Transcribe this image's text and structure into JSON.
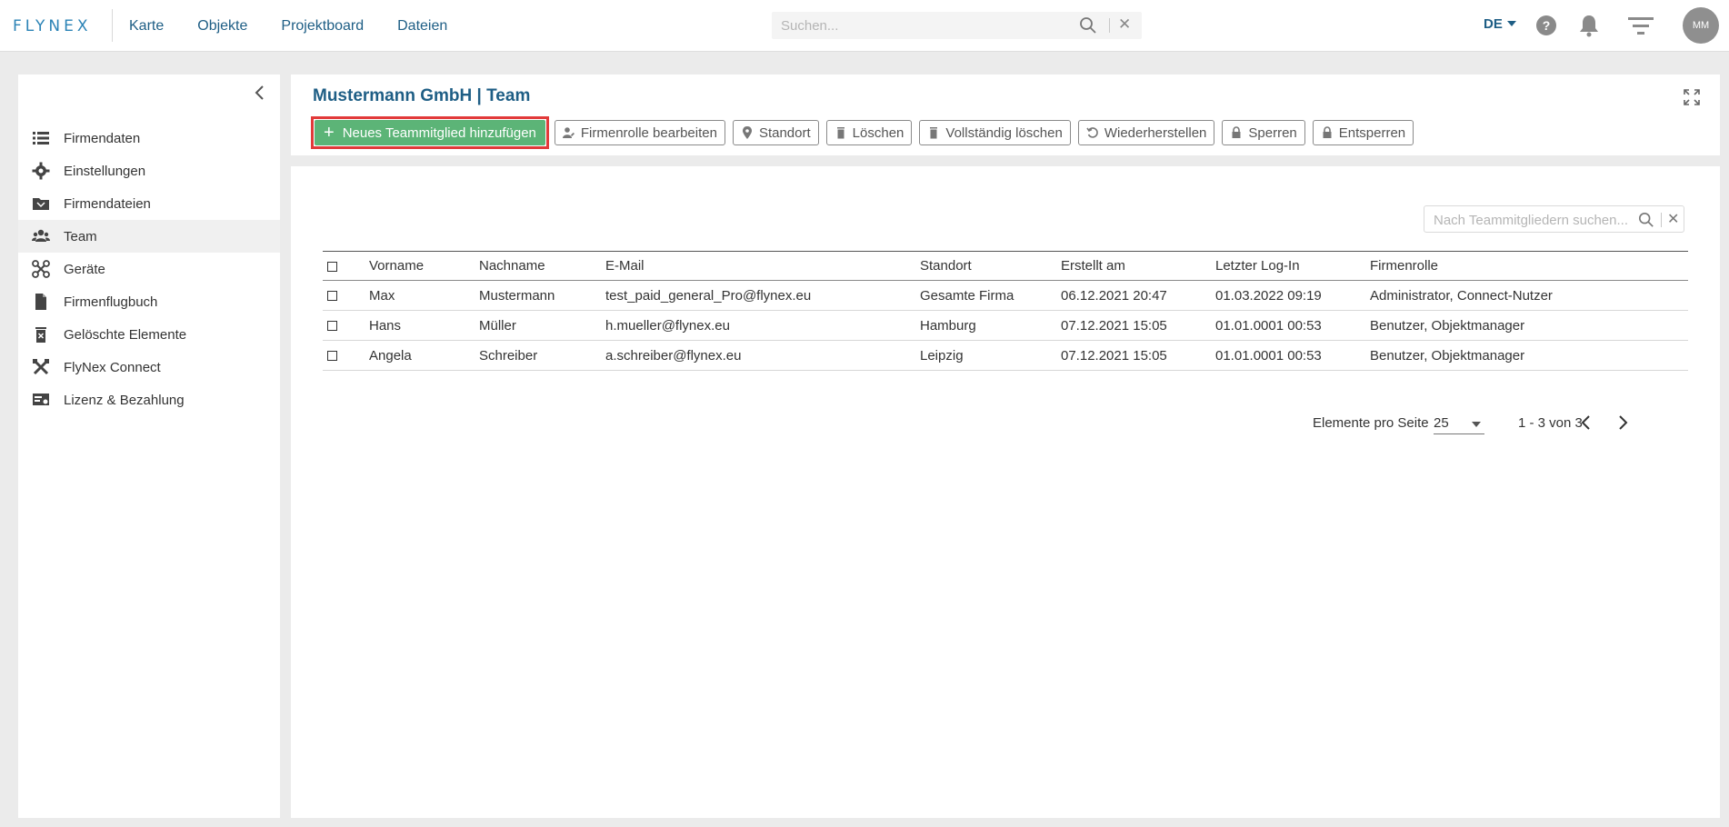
{
  "topbar": {
    "logo": "FLYNEX",
    "nav": [
      "Karte",
      "Objekte",
      "Projektboard",
      "Dateien"
    ],
    "search_placeholder": "Suchen...",
    "clear": "✕",
    "language": "DE",
    "help": "?",
    "avatar": "MM"
  },
  "sidebar": {
    "items": [
      {
        "label": "Firmendaten",
        "icon": "list-icon"
      },
      {
        "label": "Einstellungen",
        "icon": "gear-icon"
      },
      {
        "label": "Firmendateien",
        "icon": "folder-icon"
      },
      {
        "label": "Team",
        "icon": "team-icon"
      },
      {
        "label": "Geräte",
        "icon": "drone-icon"
      },
      {
        "label": "Firmenflugbuch",
        "icon": "file-icon"
      },
      {
        "label": "Gelöschte Elemente",
        "icon": "trash-icon"
      },
      {
        "label": "FlyNex Connect",
        "icon": "tools-icon"
      },
      {
        "label": "Lizenz & Bezahlung",
        "icon": "license-icon"
      }
    ],
    "active": "Team"
  },
  "header": {
    "title": "Mustermann GmbH | Team",
    "primary_button": "Neues Teammitglied hinzufügen",
    "buttons": [
      "Firmenrolle bearbeiten",
      "Standort",
      "Löschen",
      "Vollständig löschen",
      "Wiederherstellen",
      "Sperren",
      "Entsperren"
    ]
  },
  "table": {
    "search_placeholder": "Nach Teammitgliedern suchen...",
    "clear": "✕",
    "columns": [
      "Vorname",
      "Nachname",
      "E-Mail",
      "Standort",
      "Erstellt am",
      "Letzter Log-In",
      "Firmenrolle"
    ],
    "rows": [
      [
        "Max",
        "Mustermann",
        "test_paid_general_Pro@flynex.eu",
        "Gesamte Firma",
        "06.12.2021 20:47",
        "01.03.2022 09:19",
        "Administrator, Connect-Nutzer"
      ],
      [
        "Hans",
        "Müller",
        "h.mueller@flynex.eu",
        "Hamburg",
        "07.12.2021 15:05",
        "01.01.0001 00:53",
        "Benutzer, Objektmanager"
      ],
      [
        "Angela",
        "Schreiber",
        "a.schreiber@flynex.eu",
        "Leipzig",
        "07.12.2021 15:05",
        "01.01.0001 00:53",
        "Benutzer, Objektmanager"
      ]
    ]
  },
  "pager": {
    "label": "Elemente pro Seite",
    "page_size": "25",
    "range": "1 - 3 von 3"
  },
  "colors": {
    "brand": "#1e5e85",
    "primary_button": "#5cb477",
    "highlight": "#e23a3a"
  }
}
